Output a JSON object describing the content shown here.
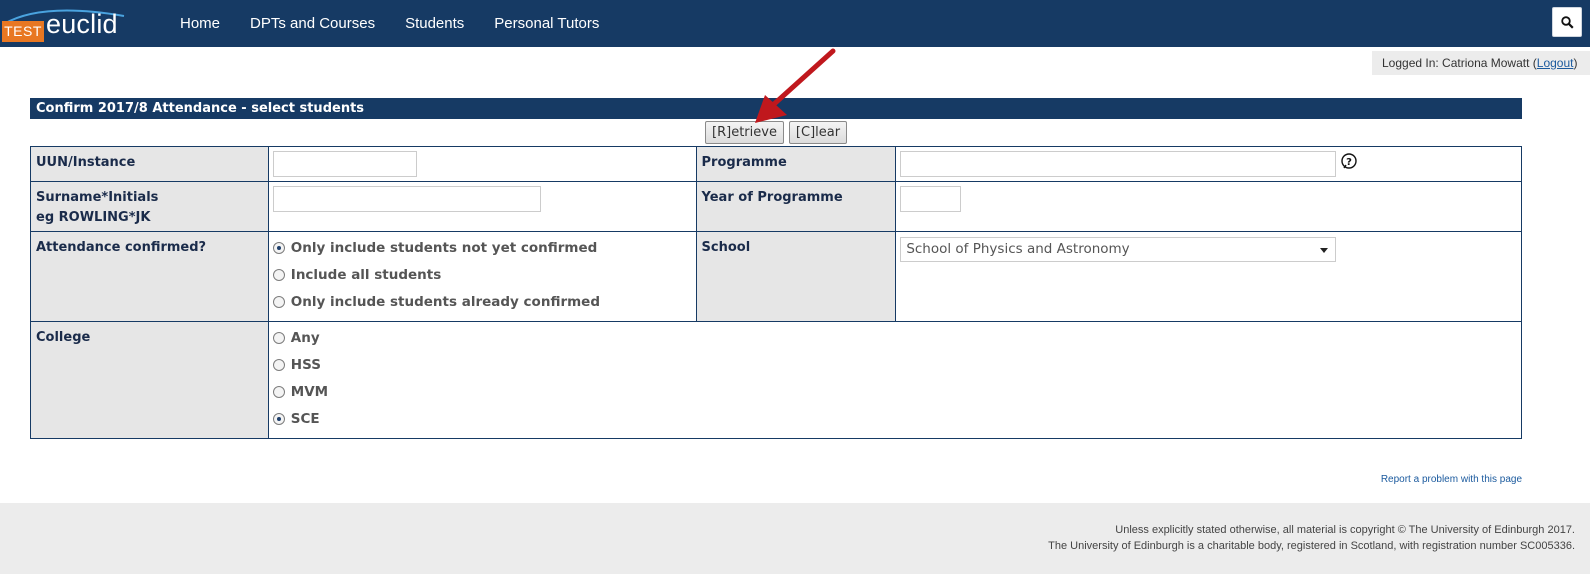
{
  "header": {
    "logo_test": "TEST",
    "logo_word": "euclid",
    "nav": [
      "Home",
      "DPTs and Courses",
      "Students",
      "Personal Tutors"
    ]
  },
  "user": {
    "logged_in_prefix": "Logged In: Catriona Mowatt (",
    "logout_label": "Logout",
    "logged_in_suffix": ")"
  },
  "panel": {
    "title": "Confirm 2017/8 Attendance - select students",
    "retrieve_label": "[R]etrieve",
    "clear_label": "[C]lear"
  },
  "form": {
    "uun_label": "UUN/Instance",
    "uun_value": "",
    "programme_label": "Programme",
    "programme_value": "",
    "surname_label_line1": "Surname*Initials",
    "surname_label_line2": "eg ROWLING*JK",
    "surname_value": "",
    "year_label": "Year of Programme",
    "year_value": "",
    "attendance_label": "Attendance confirmed?",
    "attendance_options": [
      {
        "label": "Only include students not yet confirmed",
        "selected": true
      },
      {
        "label": "Include all students",
        "selected": false
      },
      {
        "label": "Only include students already confirmed",
        "selected": false
      }
    ],
    "school_label": "School",
    "school_selected": "School of Physics and Astronomy",
    "college_label": "College",
    "college_options": [
      {
        "label": "Any",
        "selected": false
      },
      {
        "label": "HSS",
        "selected": false
      },
      {
        "label": "MVM",
        "selected": false
      },
      {
        "label": "SCE",
        "selected": true
      }
    ]
  },
  "report_link": "Report a problem with this page",
  "footer": {
    "line1": "Unless explicitly stated otherwise, all material is copyright © The University of Edinburgh 2017.",
    "line2": "The University of Edinburgh is a charitable body, registered in Scotland, with registration number SC005336."
  },
  "colors": {
    "brand_navy": "#163a64",
    "test_orange": "#e87722",
    "label_bg": "#e6e6e6",
    "annotation_arrow": "#c0181d"
  },
  "icons": {
    "search": "search-icon",
    "help": "help-icon",
    "dropdown": "chevron-down-icon",
    "annotation": "arrow-icon"
  }
}
